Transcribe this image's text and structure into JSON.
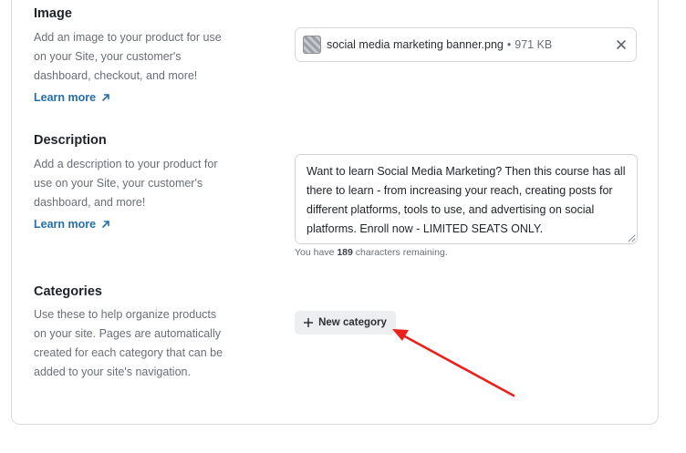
{
  "image_section": {
    "title": "Image",
    "description": "Add an image to your product for use on your Site, your customer's dashboard, checkout, and more!",
    "learn_more": "Learn more",
    "file": {
      "name": "social media marketing banner.png",
      "separator": "•",
      "size": "971 KB"
    }
  },
  "description_section": {
    "title": "Description",
    "description": "Add a description to your product for use on your Site, your customer's dashboard, and more!",
    "learn_more": "Learn more",
    "text": "Want to learn Social Media Marketing? Then this course has all there to learn - from increasing your reach, creating posts for different platforms, tools to use, and advertising on social platforms. Enroll now - LIMITED SEATS ONLY.",
    "remaining_prefix": "You have",
    "remaining_count": "189",
    "remaining_suffix": "characters remaining."
  },
  "categories_section": {
    "title": "Categories",
    "description": "Use these to help organize products on your site. Pages are automatically created for each category that can be added to your site's navigation.",
    "new_category_label": "New category"
  },
  "colors": {
    "link": "#256fa8",
    "annotation_arrow": "#e8211c"
  },
  "icons": [
    "arrow-up-right-icon",
    "close-icon",
    "plus-icon",
    "image-thumbnail-icon"
  ]
}
